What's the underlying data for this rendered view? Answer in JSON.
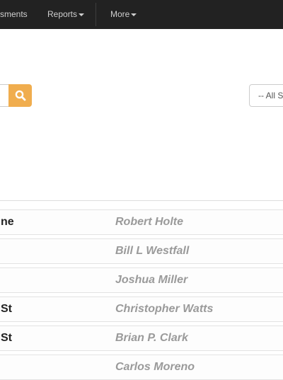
{
  "navbar": {
    "items": [
      {
        "label": "ssments",
        "caret": false
      },
      {
        "label": "Reports",
        "caret": true
      },
      {
        "label": "More",
        "caret": true
      }
    ]
  },
  "search": {
    "icon": "search-icon",
    "button_color": "#f0ad4e"
  },
  "filter": {
    "selected": "-- All S"
  },
  "list": {
    "rows": [
      {
        "name": "ne",
        "person": "Robert Holte"
      },
      {
        "name": "",
        "person": "Bill L Westfall"
      },
      {
        "name": "",
        "person": "Joshua Miller"
      },
      {
        "name": "St",
        "person": "Christopher Watts"
      },
      {
        "name": "St",
        "person": "Brian P. Clark"
      },
      {
        "name": "",
        "person": "Carlos Moreno"
      }
    ]
  }
}
